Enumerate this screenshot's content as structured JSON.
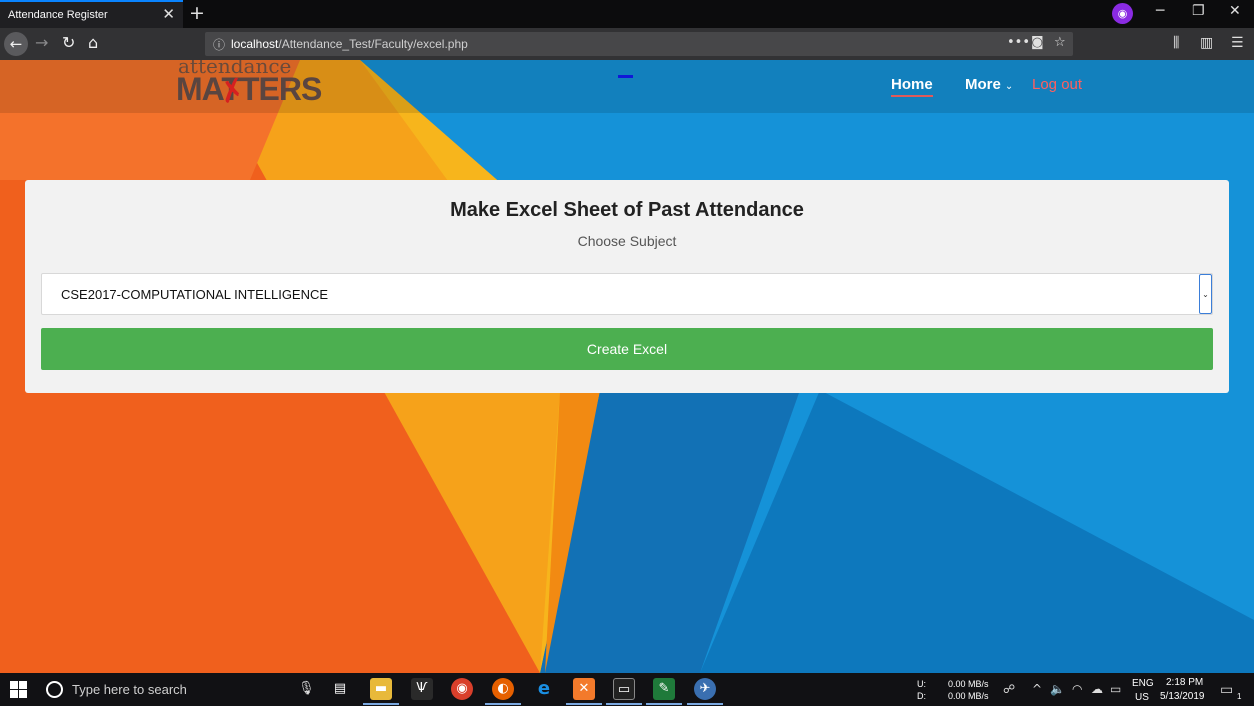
{
  "browser": {
    "tab_title": "Attendance Register",
    "url_host": "localhost",
    "url_path": "/Attendance_Test/Faculty/excel.php",
    "icons": [
      "back-icon",
      "forward-icon",
      "reload-icon",
      "home-icon",
      "info-icon",
      "more-dots-icon",
      "pocket-icon",
      "star-icon",
      "library-icon",
      "sidebar-icon",
      "menu-icon",
      "private-mask-icon"
    ]
  },
  "site": {
    "logo_top": "attendance",
    "logo_main": "MATTERS",
    "nav": {
      "home": "Home",
      "more": "More",
      "logout": "Log out"
    },
    "colors": {
      "logout": "#ff5f5f",
      "button": "#4caf50",
      "home_underline": "#e15a5a"
    }
  },
  "form": {
    "title": "Make Excel Sheet of Past Attendance",
    "subtitle": "Choose Subject",
    "selected_subject": "CSE2017-COMPUTATIONAL INTELLIGENCE",
    "submit_label": "Create Excel"
  },
  "taskbar": {
    "search_placeholder": "Type here to search",
    "net_up_label": "U:",
    "net_down_label": "D:",
    "net_up": "0.00 MB/s",
    "net_down": "0.00 MB/s",
    "lang_top": "ENG",
    "lang_bottom": "US",
    "time": "2:18 PM",
    "date": "5/13/2019",
    "notifications": "1"
  }
}
